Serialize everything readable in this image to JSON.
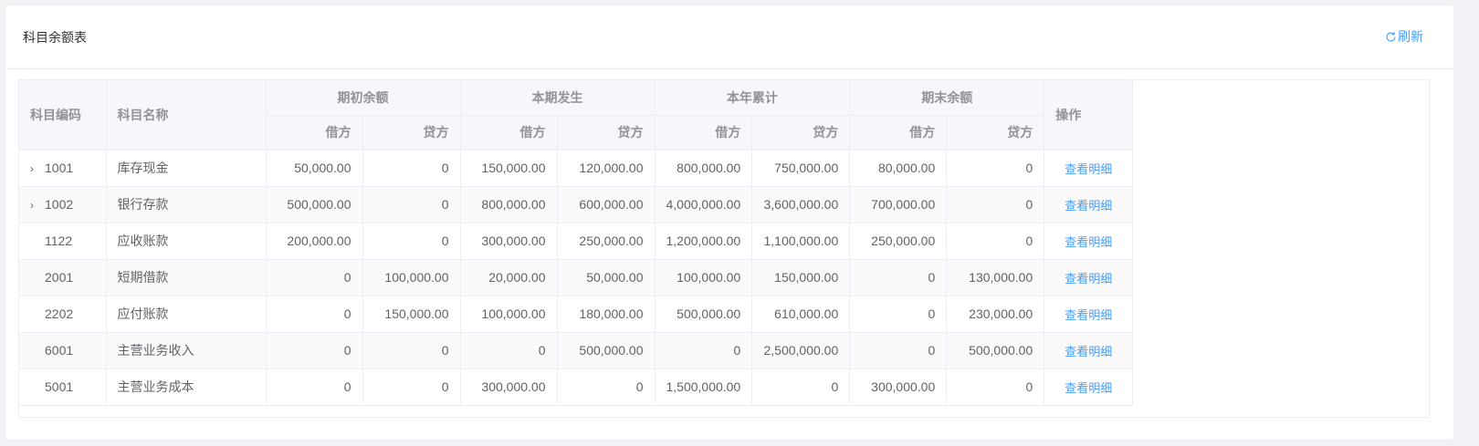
{
  "card": {
    "title": "科目余额表",
    "refresh_label": "刷新",
    "refresh_icon": "refresh-icon"
  },
  "table": {
    "headers": {
      "code": "科目编码",
      "name": "科目名称",
      "groups": [
        "期初余额",
        "本期发生",
        "本年累计",
        "期末余额"
      ],
      "debit": "借方",
      "credit": "贷方",
      "action": "操作"
    },
    "action_label": "查看明细",
    "rows": [
      {
        "expandable": true,
        "code": "1001",
        "name": "库存现金",
        "values": [
          "50,000.00",
          "0",
          "150,000.00",
          "120,000.00",
          "800,000.00",
          "750,000.00",
          "80,000.00",
          "0"
        ]
      },
      {
        "expandable": true,
        "code": "1002",
        "name": "银行存款",
        "values": [
          "500,000.00",
          "0",
          "800,000.00",
          "600,000.00",
          "4,000,000.00",
          "3,600,000.00",
          "700,000.00",
          "0"
        ]
      },
      {
        "expandable": false,
        "code": "1122",
        "name": "应收账款",
        "values": [
          "200,000.00",
          "0",
          "300,000.00",
          "250,000.00",
          "1,200,000.00",
          "1,100,000.00",
          "250,000.00",
          "0"
        ]
      },
      {
        "expandable": false,
        "code": "2001",
        "name": "短期借款",
        "values": [
          "0",
          "100,000.00",
          "20,000.00",
          "50,000.00",
          "100,000.00",
          "150,000.00",
          "0",
          "130,000.00"
        ]
      },
      {
        "expandable": false,
        "code": "2202",
        "name": "应付账款",
        "values": [
          "0",
          "150,000.00",
          "100,000.00",
          "180,000.00",
          "500,000.00",
          "610,000.00",
          "0",
          "230,000.00"
        ]
      },
      {
        "expandable": false,
        "code": "6001",
        "name": "主营业务收入",
        "values": [
          "0",
          "0",
          "0",
          "500,000.00",
          "0",
          "2,500,000.00",
          "0",
          "500,000.00"
        ]
      },
      {
        "expandable": false,
        "code": "5001",
        "name": "主营业务成本",
        "values": [
          "0",
          "0",
          "300,000.00",
          "0",
          "1,500,000.00",
          "0",
          "300,000.00",
          "0"
        ]
      }
    ]
  },
  "colors": {
    "accent": "#409eff",
    "header_bg": "#f5f7fa",
    "stripe_bg": "#fafafa",
    "border": "#ebeef5"
  }
}
